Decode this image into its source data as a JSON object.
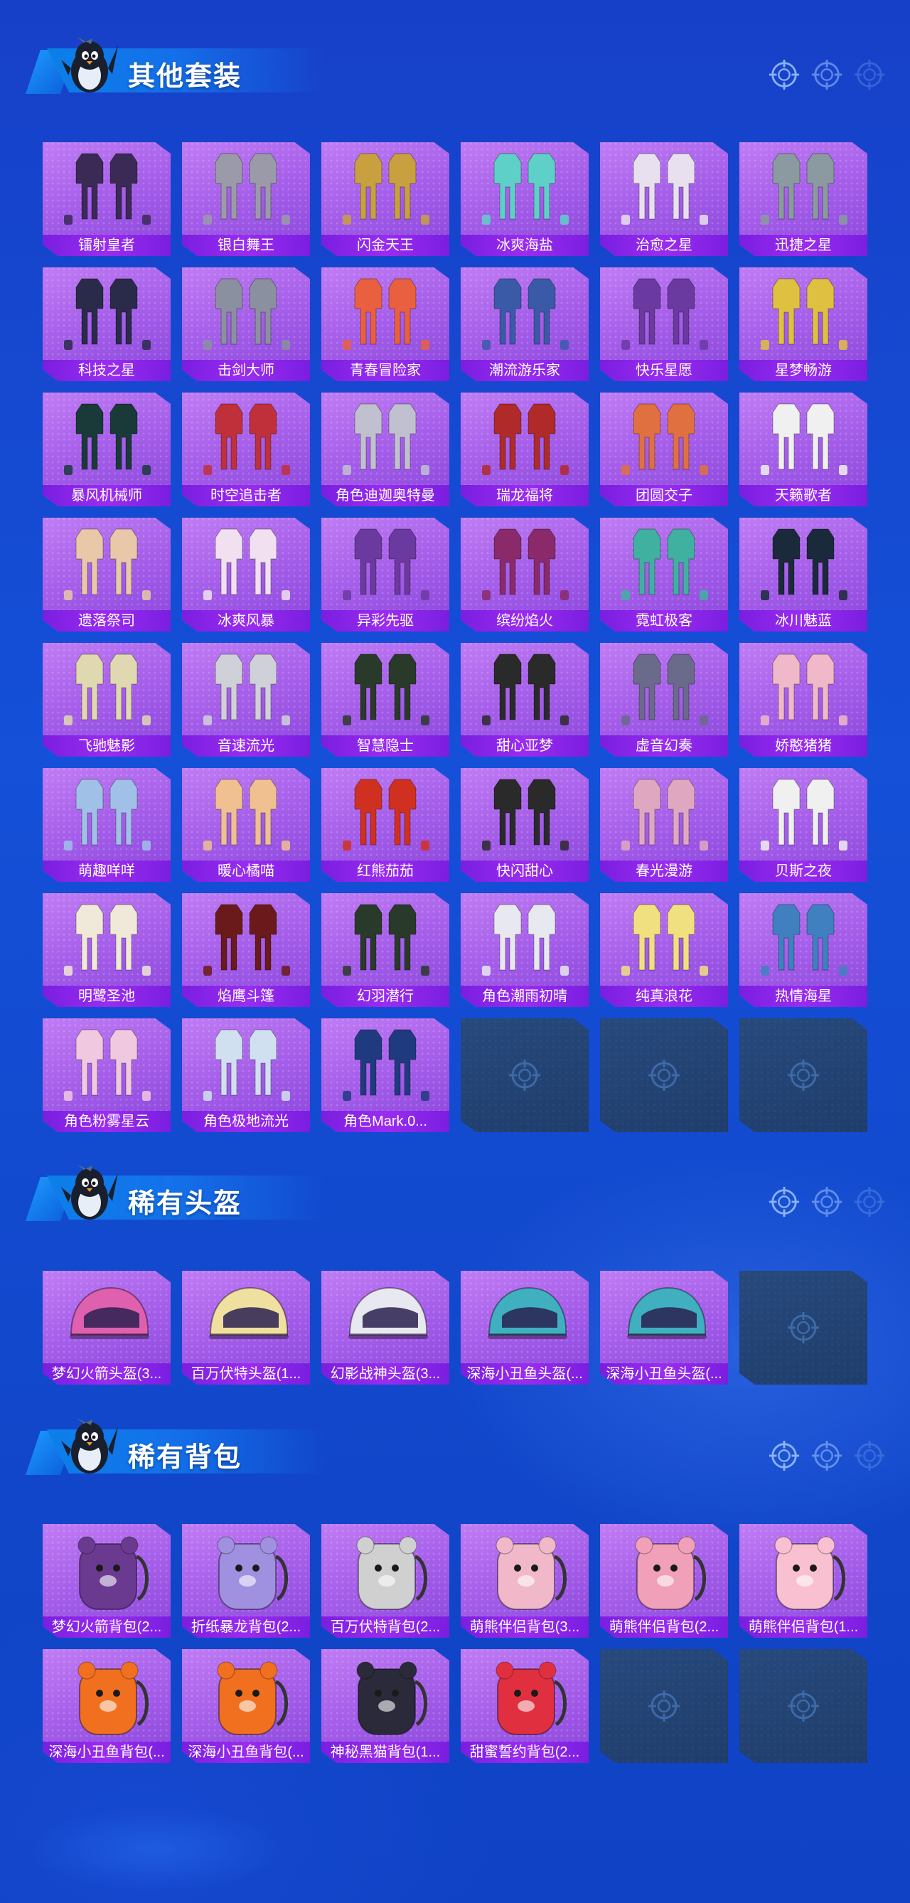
{
  "sections": [
    {
      "title": "其他套装",
      "kind": "outfit",
      "items": [
        {
          "name": "镭射皇者",
          "hue": "#3a2a55"
        },
        {
          "name": "银白舞王",
          "hue": "#9a9aa8"
        },
        {
          "name": "闪金天王",
          "hue": "#c8a040"
        },
        {
          "name": "冰爽海盐",
          "hue": "#5fd0c8"
        },
        {
          "name": "治愈之星",
          "hue": "#e8e0ee"
        },
        {
          "name": "迅捷之星",
          "hue": "#8a9aa0"
        },
        {
          "name": "科技之星",
          "hue": "#2a2a4a"
        },
        {
          "name": "击剑大师",
          "hue": "#8a90a0"
        },
        {
          "name": "青春冒险家",
          "hue": "#e86040"
        },
        {
          "name": "潮流游乐家",
          "hue": "#3a5aa8"
        },
        {
          "name": "快乐星愿",
          "hue": "#6a3aa0"
        },
        {
          "name": "星梦畅游",
          "hue": "#e0c040"
        },
        {
          "name": "暴风机械师",
          "hue": "#1a3a3a"
        },
        {
          "name": "时空追击者",
          "hue": "#c0303a"
        },
        {
          "name": "角色迪迦奥特曼",
          "hue": "#c0c0d0"
        },
        {
          "name": "瑞龙福将",
          "hue": "#b02a2a"
        },
        {
          "name": "团圆交子",
          "hue": "#e07040"
        },
        {
          "name": "天籁歌者",
          "hue": "#f0f0f0"
        },
        {
          "name": "遗落祭司",
          "hue": "#e8c8a8"
        },
        {
          "name": "冰爽风暴",
          "hue": "#f0e0f0"
        },
        {
          "name": "异彩先驱",
          "hue": "#6a3aa0"
        },
        {
          "name": "缤纷焰火",
          "hue": "#8a2a6a"
        },
        {
          "name": "霓虹极客",
          "hue": "#40b0a0"
        },
        {
          "name": "冰川魅蓝",
          "hue": "#1a2a3a"
        },
        {
          "name": "飞驰魅影",
          "hue": "#e0d8b0"
        },
        {
          "name": "音速流光",
          "hue": "#d0d0d8"
        },
        {
          "name": "智慧隐士",
          "hue": "#2a3a2a"
        },
        {
          "name": "甜心亚梦",
          "hue": "#2a2a2a"
        },
        {
          "name": "虚音幻奏",
          "hue": "#6a6a8a"
        },
        {
          "name": "娇憨猪猪",
          "hue": "#f0b8c8"
        },
        {
          "name": "萌趣咩咩",
          "hue": "#a0c0e8"
        },
        {
          "name": "暖心橘喵",
          "hue": "#f0c090"
        },
        {
          "name": "红熊茄茄",
          "hue": "#d03020"
        },
        {
          "name": "快闪甜心",
          "hue": "#2a2a2a"
        },
        {
          "name": "春光漫游",
          "hue": "#e0a8c0"
        },
        {
          "name": "贝斯之夜",
          "hue": "#f0f0f0"
        },
        {
          "name": "明鹭圣池",
          "hue": "#f0e8d8"
        },
        {
          "name": "焰鹰斗篷",
          "hue": "#6a1a1a"
        },
        {
          "name": "幻羽潜行",
          "hue": "#2a3a2a"
        },
        {
          "name": "角色潮雨初晴",
          "hue": "#e8e8f0"
        },
        {
          "name": "纯真浪花",
          "hue": "#f0e080"
        },
        {
          "name": "热情海星",
          "hue": "#4080c0"
        },
        {
          "name": "角色粉雾星云",
          "hue": "#f0c8e0"
        },
        {
          "name": "角色极地流光",
          "hue": "#d0e0f0"
        },
        {
          "name": "角色Mark.0...",
          "hue": "#203a80"
        },
        null,
        null,
        null
      ]
    },
    {
      "title": "稀有头盔",
      "kind": "helmet",
      "items": [
        {
          "name": "梦幻火箭头盔(3...",
          "hue": "#e060b0"
        },
        {
          "name": "百万伏特头盔(1...",
          "hue": "#f0e0a0"
        },
        {
          "name": "幻影战神头盔(3...",
          "hue": "#e8e8f0"
        },
        {
          "name": "深海小丑鱼头盔(...",
          "hue": "#40b0c0"
        },
        {
          "name": "深海小丑鱼头盔(...",
          "hue": "#40b0c0"
        },
        null
      ]
    },
    {
      "title": "稀有背包",
      "kind": "backpack",
      "items": [
        {
          "name": "梦幻火箭背包(2...",
          "hue": "#6a3a90"
        },
        {
          "name": "折纸暴龙背包(2...",
          "hue": "#a090e0"
        },
        {
          "name": "百万伏特背包(2...",
          "hue": "#d0d0d0"
        },
        {
          "name": "萌熊伴侣背包(3...",
          "hue": "#f0b8c8"
        },
        {
          "name": "萌熊伴侣背包(2...",
          "hue": "#f0a0b8"
        },
        {
          "name": "萌熊伴侣背包(1...",
          "hue": "#f8c0d0"
        },
        {
          "name": "深海小丑鱼背包(...",
          "hue": "#f07020"
        },
        {
          "name": "深海小丑鱼背包(...",
          "hue": "#f07020"
        },
        {
          "name": "神秘黑猫背包(1...",
          "hue": "#2a2a3a"
        },
        {
          "name": "甜蜜誓约背包(2...",
          "hue": "#e03040"
        },
        null,
        null
      ]
    }
  ],
  "colors": {
    "card_purple": "#a760ea",
    "label_bar": "#8a24e8",
    "empty_slot": "#243f70",
    "background": "#1548d0"
  },
  "icons": {
    "mascot": "penguin-mascot-icon",
    "crosshair": "crosshair-icon"
  }
}
